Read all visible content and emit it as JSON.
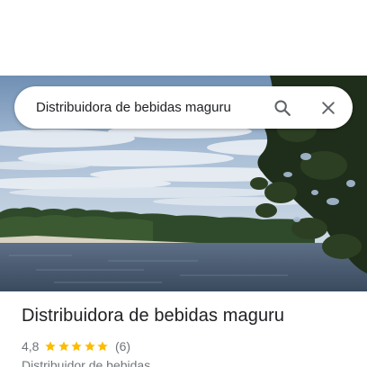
{
  "search": {
    "query": "Distribuidora de bebidas maguru",
    "search_icon": "magnify-icon",
    "close_icon": "close-icon"
  },
  "hero": {
    "description_icon": "place-photo"
  },
  "place": {
    "name": "Distribuidora de bebidas maguru",
    "rating": "4,8",
    "rating_fraction": 0.96,
    "star_count": 5,
    "reviews": "(6)",
    "category": "Distribuidor de bebidas"
  },
  "colors": {
    "star": "#fbbc04",
    "text_primary": "#202124",
    "text_secondary": "#70757a",
    "icon": "#5f6368"
  }
}
